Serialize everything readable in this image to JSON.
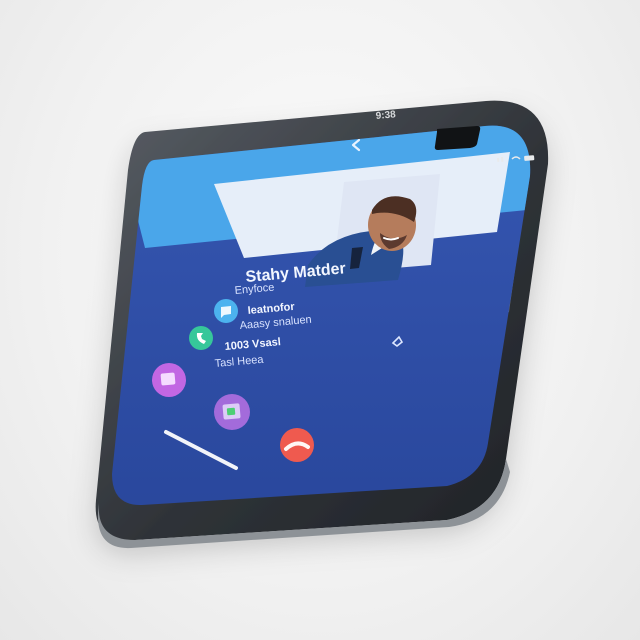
{
  "contact": {
    "name": "Stahy Matder",
    "subtitle": "Enyfoce"
  },
  "status_bar": {
    "time": "9:38"
  },
  "details": [
    {
      "icon": "message-icon",
      "line1": "Ieatnofor",
      "line2": "Aaasy snaluen"
    },
    {
      "icon": "phone-icon",
      "line1": "1003 Vsasl",
      "line2": "Tasl Heea"
    }
  ],
  "colors": {
    "header": "#4aa6ea",
    "panel": "#2f4fa6",
    "photo_frame": "#e6eef9",
    "message_icon": "#4cb3ef",
    "phone_icon": "#36c79a",
    "left_action": "#c267e3",
    "center_action": "#a36bdb",
    "end_call": "#ef5a4f"
  }
}
